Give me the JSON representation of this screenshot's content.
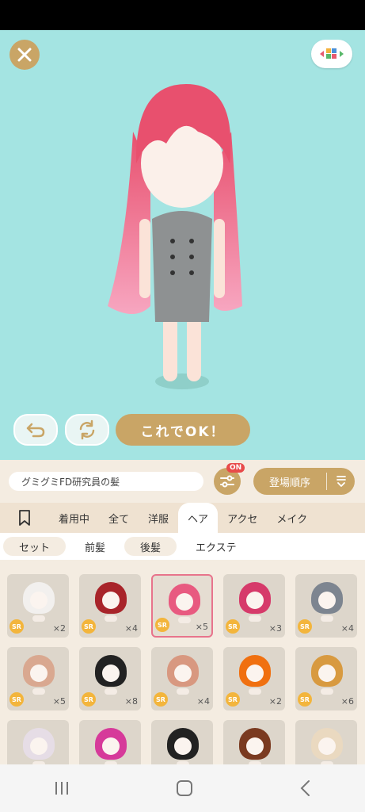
{
  "preview": {
    "ok_label": "これでOK！"
  },
  "filterbar": {
    "item_name": "グミグミFD研究員の髪",
    "filter_badge": "ON",
    "sort_label": "登場順序"
  },
  "tabs": [
    {
      "label": "着用中"
    },
    {
      "label": "全て"
    },
    {
      "label": "洋服"
    },
    {
      "label": "ヘア",
      "active": true
    },
    {
      "label": "アクセ"
    },
    {
      "label": "メイク"
    }
  ],
  "subtabs": [
    {
      "label": "セット"
    },
    {
      "label": "前髪",
      "active": true
    },
    {
      "label": "後髪"
    },
    {
      "label": "エクステ"
    }
  ],
  "items": [
    {
      "rarity": "SR",
      "count": "×2",
      "hair_color": "#f2f0ee"
    },
    {
      "rarity": "SR",
      "count": "×4",
      "hair_color": "#a8242a"
    },
    {
      "rarity": "SR",
      "count": "×5",
      "hair_color": "#e85a80",
      "selected": true
    },
    {
      "rarity": "SR",
      "count": "×3",
      "hair_color": "#d63a6a"
    },
    {
      "rarity": "SR",
      "count": "×4",
      "hair_color": "#7d8590"
    },
    {
      "rarity": "SR",
      "count": "×5",
      "hair_color": "#d9a890"
    },
    {
      "rarity": "SR",
      "count": "×8",
      "hair_color": "#222222"
    },
    {
      "rarity": "SR",
      "count": "×4",
      "hair_color": "#d89880"
    },
    {
      "rarity": "SR",
      "count": "×2",
      "hair_color": "#f07010"
    },
    {
      "rarity": "SR",
      "count": "×6",
      "hair_color": "#d89a40"
    },
    {
      "hair_color": "#e6dde6"
    },
    {
      "hair_color": "#d63a9a"
    },
    {
      "hair_color": "#222222"
    },
    {
      "hair_color": "#7a3a20"
    },
    {
      "hair_color": "#ead9c0"
    }
  ]
}
